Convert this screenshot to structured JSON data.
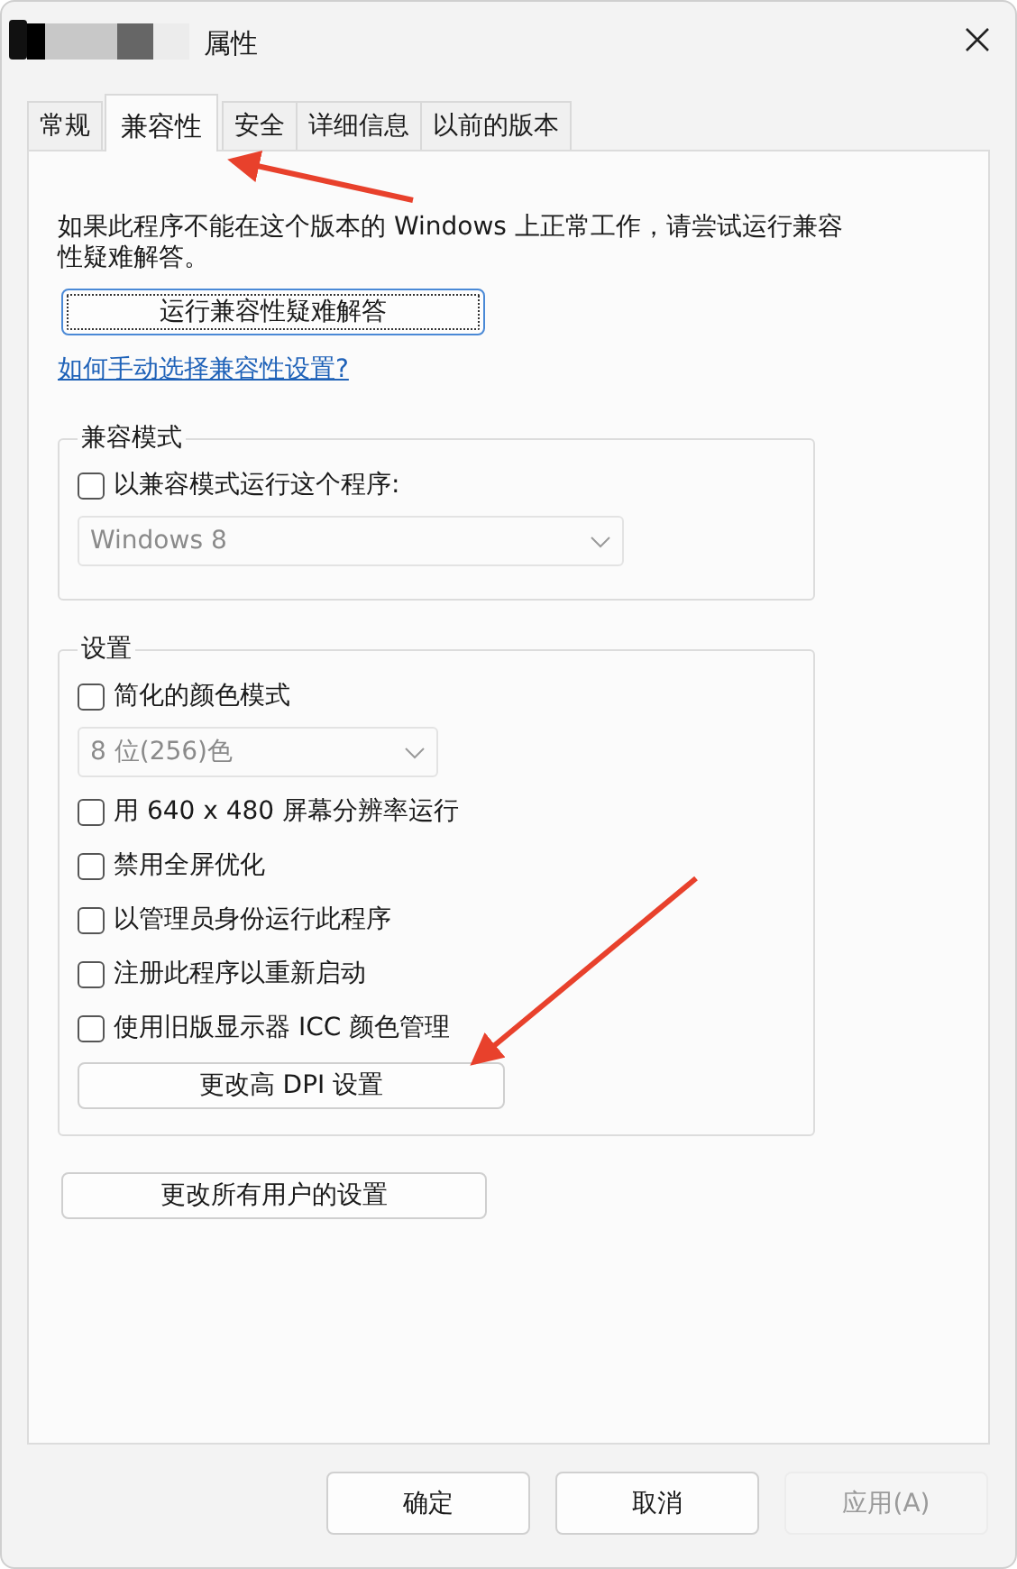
{
  "window": {
    "title": "属性",
    "title_redacted": true
  },
  "tabs": [
    {
      "label": "常规",
      "selected": false
    },
    {
      "label": "兼容性",
      "selected": true
    },
    {
      "label": "安全",
      "selected": false
    },
    {
      "label": "详细信息",
      "selected": false
    },
    {
      "label": "以前的版本",
      "selected": false
    }
  ],
  "description": "如果此程序不能在这个版本的 Windows 上正常工作，请尝试运行兼容性疑难解答。",
  "troubleshoot_button": {
    "label": "运行兼容性疑难解答",
    "focused": true
  },
  "help_link": "如何手动选择兼容性设置?",
  "compat_mode": {
    "title": "兼容模式",
    "items": [
      {
        "kind": "checkbox",
        "label": "以兼容模式运行这个程序:",
        "checked": false
      },
      {
        "kind": "dropdown",
        "value": "Windows 8",
        "disabled": true
      }
    ]
  },
  "settings": {
    "title": "设置",
    "items": [
      {
        "kind": "checkbox",
        "label": "简化的颜色模式",
        "checked": false
      },
      {
        "kind": "dropdown",
        "value": "8 位(256)色",
        "disabled": true
      },
      {
        "kind": "checkbox",
        "label": "用 640 x 480 屏幕分辨率运行",
        "checked": false
      },
      {
        "kind": "checkbox",
        "label": "禁用全屏优化",
        "checked": false
      },
      {
        "kind": "checkbox",
        "label": "以管理员身份运行此程序",
        "checked": false
      },
      {
        "kind": "checkbox",
        "label": "注册此程序以重新启动",
        "checked": false
      },
      {
        "kind": "checkbox",
        "label": "使用旧版显示器 ICC 颜色管理",
        "checked": false
      },
      {
        "kind": "button",
        "label": "更改高 DPI 设置"
      }
    ]
  },
  "all_users_button": {
    "label": "更改所有用户的设置"
  },
  "buttons": [
    {
      "label": "确定",
      "disabled": false
    },
    {
      "label": "取消",
      "disabled": false
    },
    {
      "label": "应用(A)",
      "disabled": true
    }
  ]
}
